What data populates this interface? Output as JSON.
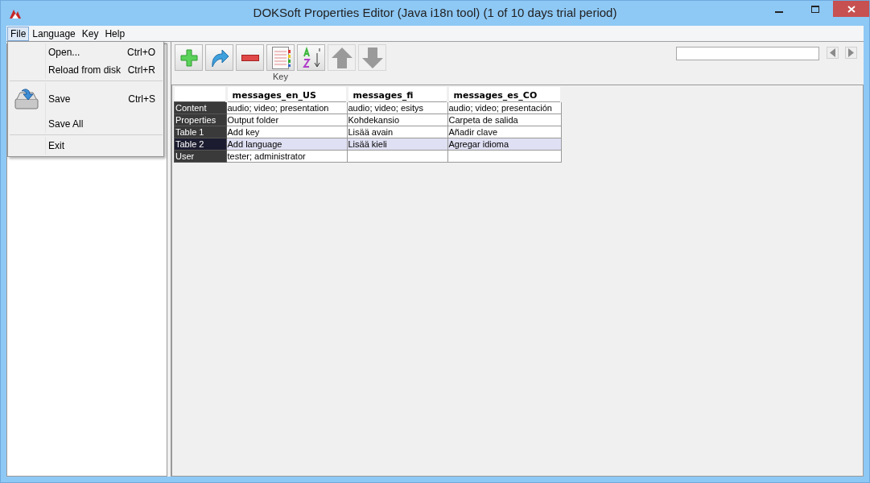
{
  "window": {
    "title": "DOKSoft Properties Editor (Java i18n tool) (1 of 10 days trial period)"
  },
  "menu_bar": [
    {
      "label": "File",
      "selected": true
    },
    {
      "label": "Language",
      "selected": false
    },
    {
      "label": "Key",
      "selected": false
    },
    {
      "label": "Help",
      "selected": false
    }
  ],
  "file_menu": [
    {
      "kind": "item",
      "label": "Open...",
      "shortcut": "Ctrl+O"
    },
    {
      "kind": "item",
      "label": "Reload from disk",
      "shortcut": "Ctrl+R"
    },
    {
      "kind": "separator"
    },
    {
      "kind": "icon-item",
      "label": "Save",
      "shortcut": "Ctrl+S"
    },
    {
      "kind": "item",
      "label": "Save All"
    },
    {
      "kind": "separator"
    },
    {
      "kind": "item",
      "label": "Exit"
    }
  ],
  "toolbar": [
    {
      "kind": "add",
      "disabled": false
    },
    {
      "kind": "redo",
      "disabled": false
    },
    {
      "kind": "remove",
      "disabled": false
    },
    {
      "kind": "notebook",
      "disabled": false,
      "caption": "Key"
    },
    {
      "kind": "sort",
      "disabled": false
    },
    {
      "kind": "up",
      "disabled": true
    },
    {
      "kind": "down",
      "disabled": true
    }
  ],
  "table": {
    "columns": [
      "messages_en_US",
      "messages_fi",
      "messages_es_CO"
    ],
    "rows": [
      {
        "key": "Content",
        "selected": false,
        "cells": [
          "audio; video; presentation",
          "audio; video; esitys",
          "audio; video; presentación"
        ]
      },
      {
        "key": "Properties",
        "selected": false,
        "cells": [
          "Output folder",
          "Kohdekansio",
          "Carpeta de salida"
        ]
      },
      {
        "key": "Table 1",
        "selected": false,
        "cells": [
          "Add key",
          "Lisää avain",
          "Añadir clave"
        ]
      },
      {
        "key": "Table 2",
        "selected": true,
        "cells": [
          "Add language",
          "Lisää kieli",
          "Agregar idioma"
        ]
      },
      {
        "key": "User",
        "selected": false,
        "cells": [
          "tester; administrator",
          "",
          ""
        ]
      }
    ]
  }
}
